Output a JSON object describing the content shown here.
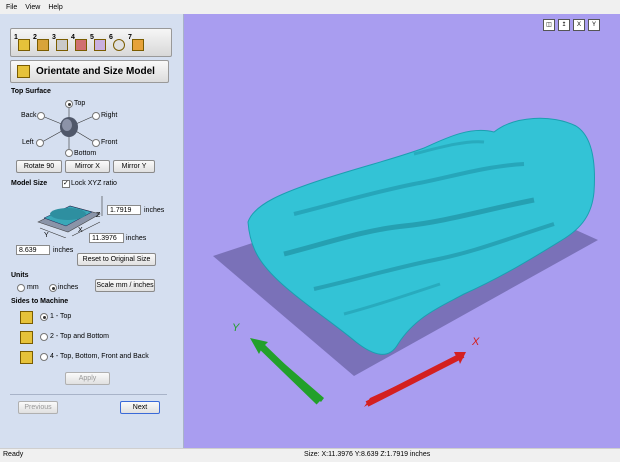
{
  "menu": {
    "file": "File",
    "view": "View",
    "help": "Help"
  },
  "wizard": {
    "steps": [
      "1",
      "2",
      "3",
      "4",
      "5",
      "6",
      "7"
    ],
    "title": "Orientate and Size Model"
  },
  "top_surface": {
    "heading": "Top Surface",
    "top": "Top",
    "back": "Back",
    "right": "Right",
    "left": "Left",
    "front": "Front",
    "bottom": "Bottom",
    "selected": "Top",
    "rotate_label": "Rotate 90",
    "mirror_x_label": "Mirror X",
    "mirror_y_label": "Mirror Y"
  },
  "model_size": {
    "heading": "Model Size",
    "lock_label": "Lock XYZ ratio",
    "lock_checked": true,
    "z_value": "1.7919",
    "x_value": "11.3976",
    "y_value": "8.639",
    "unit": "inches",
    "axis_z": "Z",
    "axis_x": "X",
    "axis_y": "Y",
    "reset_label": "Reset to Original Size"
  },
  "units": {
    "heading": "Units",
    "mm": "mm",
    "inches": "inches",
    "selected": "inches",
    "scale_label": "Scale mm / inches"
  },
  "sides": {
    "heading": "Sides to Machine",
    "options": [
      "1 - Top",
      "2 - Top and Bottom",
      "4 - Top, Bottom, Front and Back"
    ],
    "selected": 0,
    "apply_label": "Apply"
  },
  "nav": {
    "previous": "Previous",
    "next": "Next"
  },
  "viewport": {
    "view_icons": [
      "iso-view-icon",
      "top-view-icon",
      "x-view-icon",
      "y-view-icon"
    ],
    "x_axis": "X",
    "y_axis": "Y",
    "model_color": "#33c3d6",
    "plane_color": "#7a71b8",
    "x_arrow_color": "#d42020",
    "y_arrow_color": "#22a02a",
    "background": "#a99df0"
  },
  "status": {
    "ready": "Ready",
    "size": "Size: X:11.3976 Y:8.639 Z:1.7919 inches"
  }
}
